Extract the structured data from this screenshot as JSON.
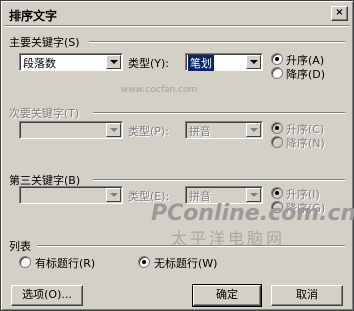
{
  "dialog": {
    "title": "排序文字",
    "close": "×"
  },
  "primary": {
    "label": "主要关键字(S)",
    "field": "段落数",
    "type_label": "类型(Y):",
    "type_value": "笔划",
    "asc": "升序(A)",
    "desc": "降序(D)"
  },
  "secondary": {
    "label": "次要关键字(T)",
    "type_label": "类型(P):",
    "type_value": "拼音",
    "asc": "升序(C)",
    "desc": "降序(N)"
  },
  "tertiary": {
    "label": "第三关键字(B)",
    "type_label": "类型(E):",
    "type_value": "拼音",
    "asc": "升序(I)",
    "desc": "降序(G)"
  },
  "list": {
    "label": "列表",
    "header_row": "有标题行(R)",
    "no_header_row": "无标题行(W)"
  },
  "buttons": {
    "options": "选项(O)...",
    "ok": "确定",
    "cancel": "取消"
  },
  "watermark": {
    "url": "www.cocfan.com",
    "brand": "PConline.com.cn",
    "brand_cn": "太平洋电脑网"
  }
}
